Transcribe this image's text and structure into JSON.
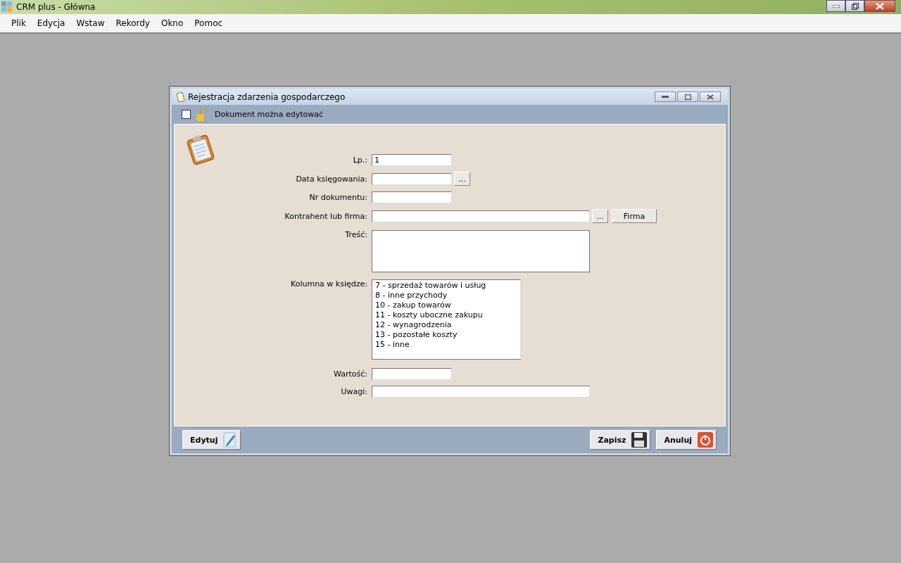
{
  "window": {
    "title": "CRM plus - Główna"
  },
  "menu": [
    "Plik",
    "Edycja",
    "Wstaw",
    "Rekordy",
    "Okno",
    "Pomoc"
  ],
  "dialog": {
    "title": "Rejestracja zdarzenia gospodarczego",
    "toolbar": {
      "checkbox": {
        "label": "Dokument można edytować",
        "checked": false
      }
    },
    "fields": [
      {
        "kind": "text",
        "label": "Lp.:",
        "value": "1"
      },
      {
        "kind": "text",
        "label": "Data księgowania:",
        "picker": "..."
      },
      {
        "kind": "text",
        "label": "Nr dokumentu:"
      },
      {
        "kind": "wide",
        "label": "Kontrahent lub firma:",
        "picker": "...",
        "button": "Firma"
      },
      {
        "kind": "memo",
        "label": "Treść:"
      },
      {
        "kind": "list",
        "label": "Kolumna w księdze:",
        "options": [
          {
            "text": "7 - sprzedaż towarów i usług",
            "selected": false
          },
          {
            "text": "8 - inne przychody",
            "selected": false
          },
          {
            "text": "10 - zakup towarów",
            "selected": false
          },
          {
            "text": "11 - koszty uboczne zakupu",
            "selected": false
          },
          {
            "text": "12 - wynagrodzenia",
            "selected": false
          },
          {
            "text": "13 - pozostałe koszty",
            "selected": false
          },
          {
            "text": "15 - inne",
            "selected": false
          }
        ]
      },
      {
        "kind": "text",
        "label": "Wartość:"
      },
      {
        "kind": "wide",
        "label": "Uwagi:"
      }
    ],
    "buttons": [
      {
        "kind": "edit",
        "label": "Edytuj"
      },
      {
        "kind": "save",
        "label": "Zapisz"
      },
      {
        "kind": "cancel",
        "label": "Anuluj"
      }
    ]
  }
}
